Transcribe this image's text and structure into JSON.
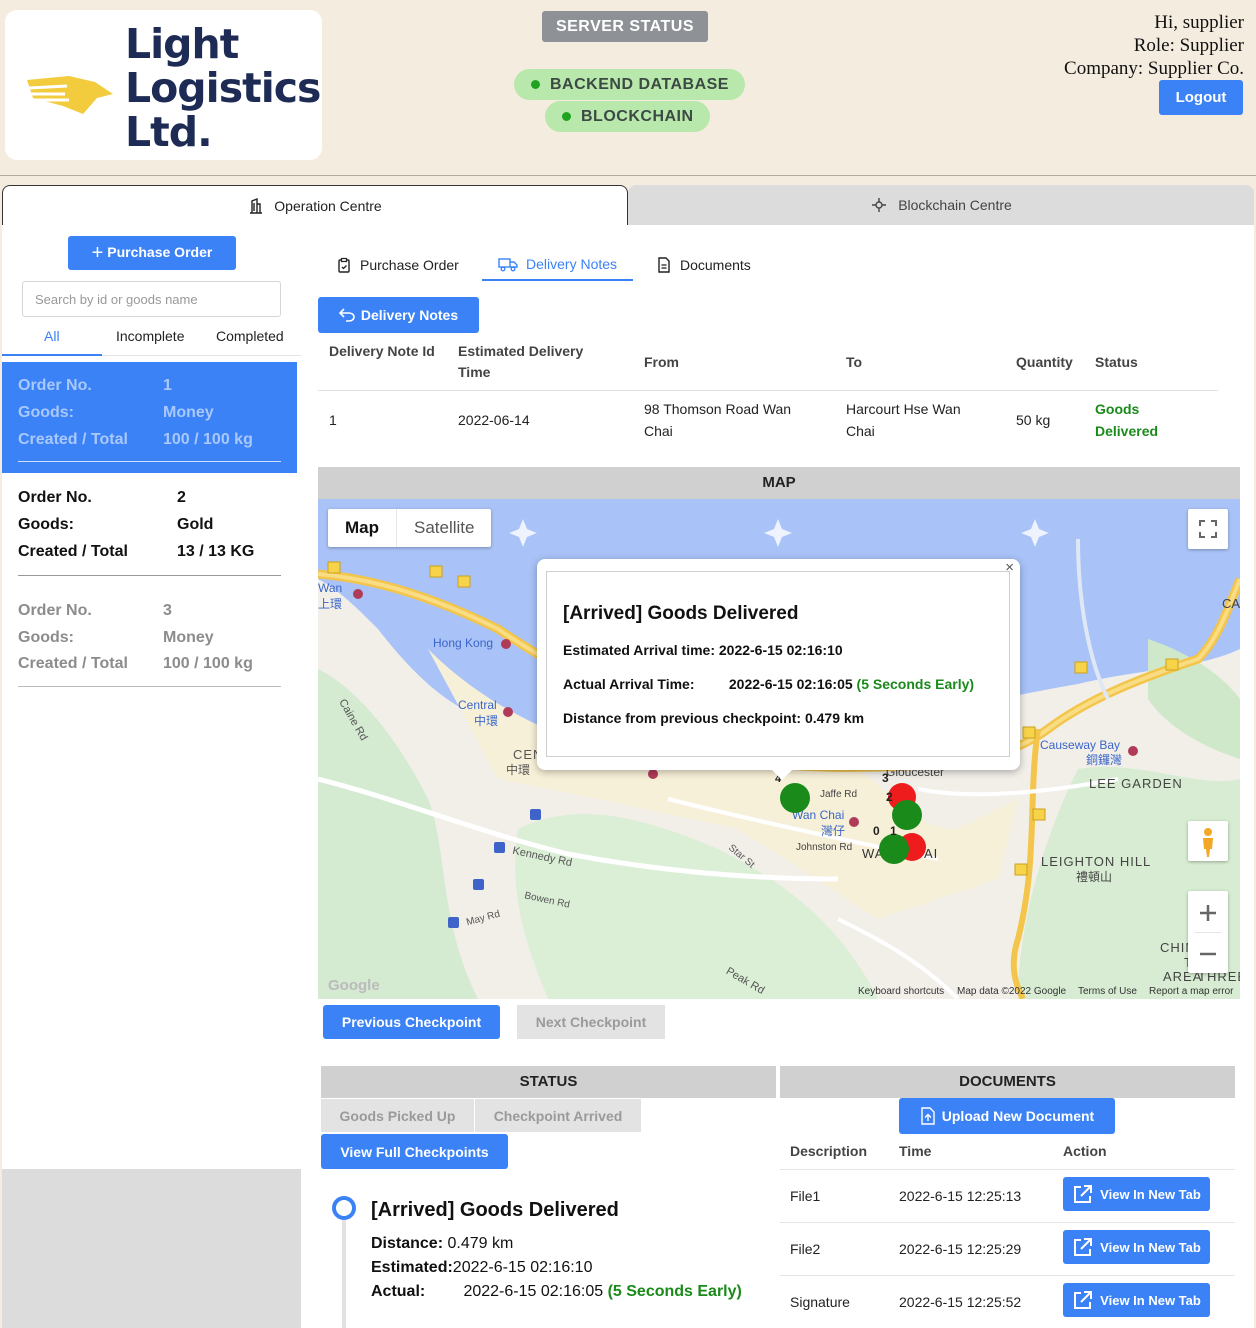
{
  "header": {
    "logo_text": "Light\nLogistics\nLtd.",
    "server_status": "SERVER STATUS",
    "backend_database": "BACKEND DATABASE",
    "blockchain": "BLOCKCHAIN",
    "greeting": "Hi, supplier",
    "role": "Role: Supplier",
    "company": "Company: Supplier Co.",
    "logout": "Logout"
  },
  "main_tabs": {
    "operation": "Operation Centre",
    "blockchain": "Blockchain Centre"
  },
  "left": {
    "purchase_order_button": "Purchase Order",
    "search_placeholder": "Search by id or goods name",
    "filters": [
      "All",
      "Incomplete",
      "Completed"
    ],
    "labels": {
      "order": "Order No.",
      "goods": "Goods:",
      "created": "Created / Total"
    },
    "orders": [
      {
        "no": "1",
        "goods": "Money",
        "created_total": "100 / 100 kg"
      },
      {
        "no": "2",
        "goods": "Gold",
        "created_total": "13 / 13 KG"
      },
      {
        "no": "3",
        "goods": "Money",
        "created_total": "100 / 100 kg"
      }
    ]
  },
  "sub_tabs": [
    "Purchase Order",
    "Delivery Notes",
    "Documents"
  ],
  "delivery_notes_button": "Delivery Notes",
  "table": {
    "headers": [
      "Delivery Note Id",
      "Estimated Delivery Time",
      "From",
      "To",
      "Quantity",
      "Status"
    ],
    "row": {
      "id": "1",
      "time": "2022-06-14",
      "from": "98 Thomson Road Wan Chai",
      "to": "Harcourt Hse Wan Chai",
      "quantity": "50 kg",
      "status": "Goods Delivered"
    }
  },
  "map": {
    "section_title": "MAP",
    "toggle_map": "Map",
    "toggle_satellite": "Satellite",
    "labels": {
      "hong_kong": "Hong Kong",
      "central": "Central",
      "central_cn": "中環",
      "centr": "CENTR",
      "centr_cn": "中環",
      "wan": "Wan",
      "wan_cn": "上環",
      "wan_chai": "Wan Chai",
      "wan_chai_cn": "灣仔",
      "causeway_bay": "Causeway Bay",
      "causeway_bay_cn": "銅鑼灣",
      "lee_garden": "LEE GARDEN",
      "leighton_hill": "LEIGHTON HILL",
      "leighton_hill_cn": "禮頓山",
      "kennedy_rd": "Kennedy Rd",
      "bowen_rd": "Bowen Rd",
      "gloucester": "Gloucester",
      "jaffe_rd": "Jaffe Rd",
      "johnston_rd": "Johnston Rd",
      "star_st": "Star St",
      "may_rd": "May Rd",
      "peak_rd": "Peak Rd",
      "caine_rd": "Caine Rd",
      "wa": "WA",
      "ai": "AI",
      "google": "Google",
      "chin": "CHIN",
      "ts": "TS",
      "area": "AREA",
      "three": "THREE",
      "ca": "CA"
    },
    "checkpoint_numbers": [
      "4",
      "3",
      "2",
      "0",
      "1"
    ],
    "popup": {
      "title": "[Arrived] Goods Delivered",
      "estimated_label": "Estimated Arrival time:",
      "estimated_value": "2022-6-15 02:16:10",
      "actual_label": "Actual Arrival Time:",
      "actual_value": "2022-6-15 02:16:05",
      "early": "(5 Seconds Early)",
      "distance_label": "Distance from previous checkpoint:",
      "distance_value": "0.479 km"
    },
    "footer": {
      "shortcuts": "Keyboard shortcuts",
      "data": "Map data ©2022 Google",
      "terms": "Terms of Use",
      "report": "Report a map error"
    }
  },
  "checkpoint_nav": {
    "previous": "Previous Checkpoint",
    "next": "Next Checkpoint"
  },
  "status": {
    "title": "STATUS",
    "picked_up": "Goods Picked Up",
    "checkpoint_arrived": "Checkpoint Arrived",
    "view_full": "View Full Checkpoints",
    "timeline": {
      "title": "[Arrived] Goods Delivered",
      "distance_label": "Distance:",
      "distance_value": "0.479 km",
      "estimated_label": "Estimated:",
      "estimated_value": "2022-6-15 02:16:10",
      "actual_label": "Actual:",
      "actual_value": "2022-6-15 02:16:05",
      "early": "(5 Seconds Early)"
    }
  },
  "documents": {
    "title": "DOCUMENTS",
    "upload": "Upload New Document",
    "headers": [
      "Description",
      "Time",
      "Action"
    ],
    "rows": [
      {
        "description": "File1",
        "time": "2022-6-15 12:25:13",
        "action": "View In New Tab"
      },
      {
        "description": "File2",
        "time": "2022-6-15 12:25:29",
        "action": "View In New Tab"
      },
      {
        "description": "Signature",
        "time": "2022-6-15 12:25:52",
        "action": "View In New Tab"
      }
    ]
  },
  "colors": {
    "primary": "#3b82f6",
    "background": "#f5ece0",
    "success": "#1a8a1a",
    "marker_green": "#1a8a1a",
    "marker_red": "#ee1c1c"
  }
}
